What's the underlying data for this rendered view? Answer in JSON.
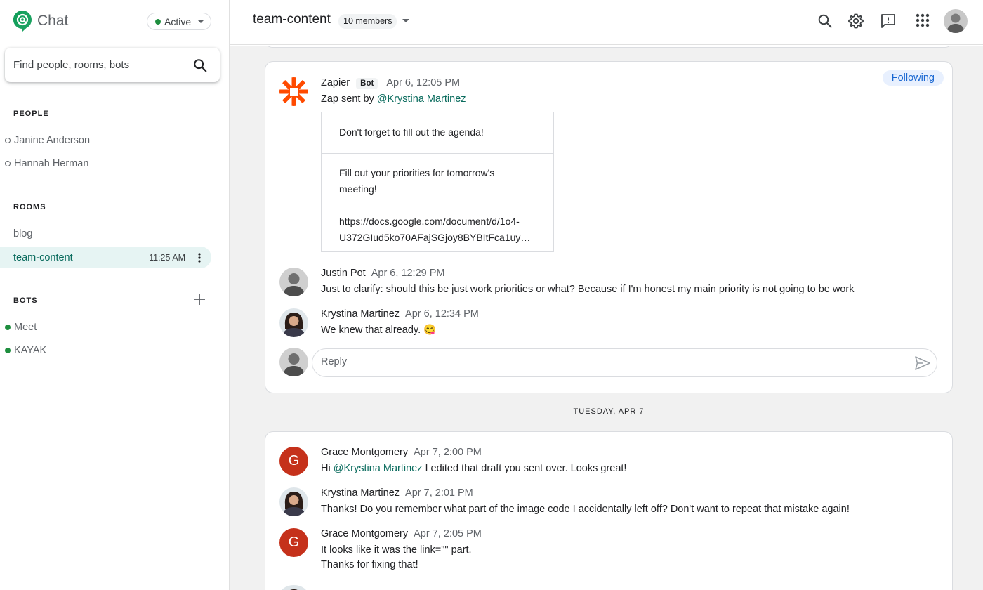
{
  "app": {
    "name": "Chat",
    "status": "Active",
    "search_placeholder": "Find people, rooms, bots"
  },
  "sidebar": {
    "people_heading": "PEOPLE",
    "people": [
      {
        "name": "Janine Anderson"
      },
      {
        "name": "Hannah Herman"
      }
    ],
    "rooms_heading": "ROOMS",
    "rooms": [
      {
        "name": "blog",
        "time": ""
      },
      {
        "name": "team-content",
        "time": "11:25 AM"
      }
    ],
    "bots_heading": "BOTS",
    "bots": [
      {
        "name": "Meet"
      },
      {
        "name": "KAYAK"
      }
    ]
  },
  "header": {
    "room": "team-content",
    "members": "10 members"
  },
  "thread1": {
    "following_label": "Following",
    "zap": {
      "sender": "Zapier",
      "badge": "Bot",
      "time": "Apr 6, 12:05 PM",
      "text_prefix": "Zap sent by ",
      "mention": "@Krystina Martinez",
      "card_title": "Don't forget to fill out the agenda!",
      "card_line1": "Fill out your priorities for tomorrow's",
      "card_line2": "meeting!",
      "card_link1": "https://docs.google.com/document/d/1o4-",
      "card_link2": "U372GIud5ko70AFajSGjoy8BYBItFca1uy…"
    },
    "messages": [
      {
        "sender": "Justin Pot",
        "time": "Apr 6, 12:29 PM",
        "text": "Just to clarify: should this be just work priorities or what? Because if I'm honest my main priority is not going to be work"
      },
      {
        "sender": "Krystina Martinez",
        "time": "Apr 6, 12:34 PM",
        "text": "We knew that already. 😋"
      }
    ],
    "reply_placeholder": "Reply"
  },
  "date_divider": "TUESDAY, APR 7",
  "thread2": {
    "messages": [
      {
        "sender": "Grace Montgomery",
        "time": "Apr 7, 2:00 PM",
        "text_prefix": "Hi ",
        "mention": "@Krystina Martinez",
        "text_suffix": " I edited that draft you sent over. Looks great!",
        "initial": "G"
      },
      {
        "sender": "Krystina Martinez",
        "time": "Apr 7, 2:01 PM",
        "text": "Thanks! Do you remember what part of the image code I accidentally left off? Don't want to repeat that mistake again!"
      },
      {
        "sender": "Grace Montgomery",
        "time": "Apr 7, 2:05 PM",
        "line1": "It looks like it was the link=\"\" part.",
        "line2": "Thanks for fixing that!",
        "initial": "G"
      }
    ]
  },
  "icons": {
    "brand": "chat-logo-icon",
    "search": "search-icon",
    "settings": "gear-icon",
    "feedback": "feedback-icon",
    "apps": "apps-grid-icon",
    "send": "send-icon",
    "more": "more-vert-icon",
    "add": "plus-icon",
    "zapier": "zapier-logo-icon"
  },
  "colors": {
    "accent": "#0b6c5e",
    "status_green": "#1e8e3e",
    "avatar_g": "#c5311b",
    "following_bg": "#e8f0fe",
    "following_text": "#1967d2",
    "zapier": "#ff4a00"
  }
}
